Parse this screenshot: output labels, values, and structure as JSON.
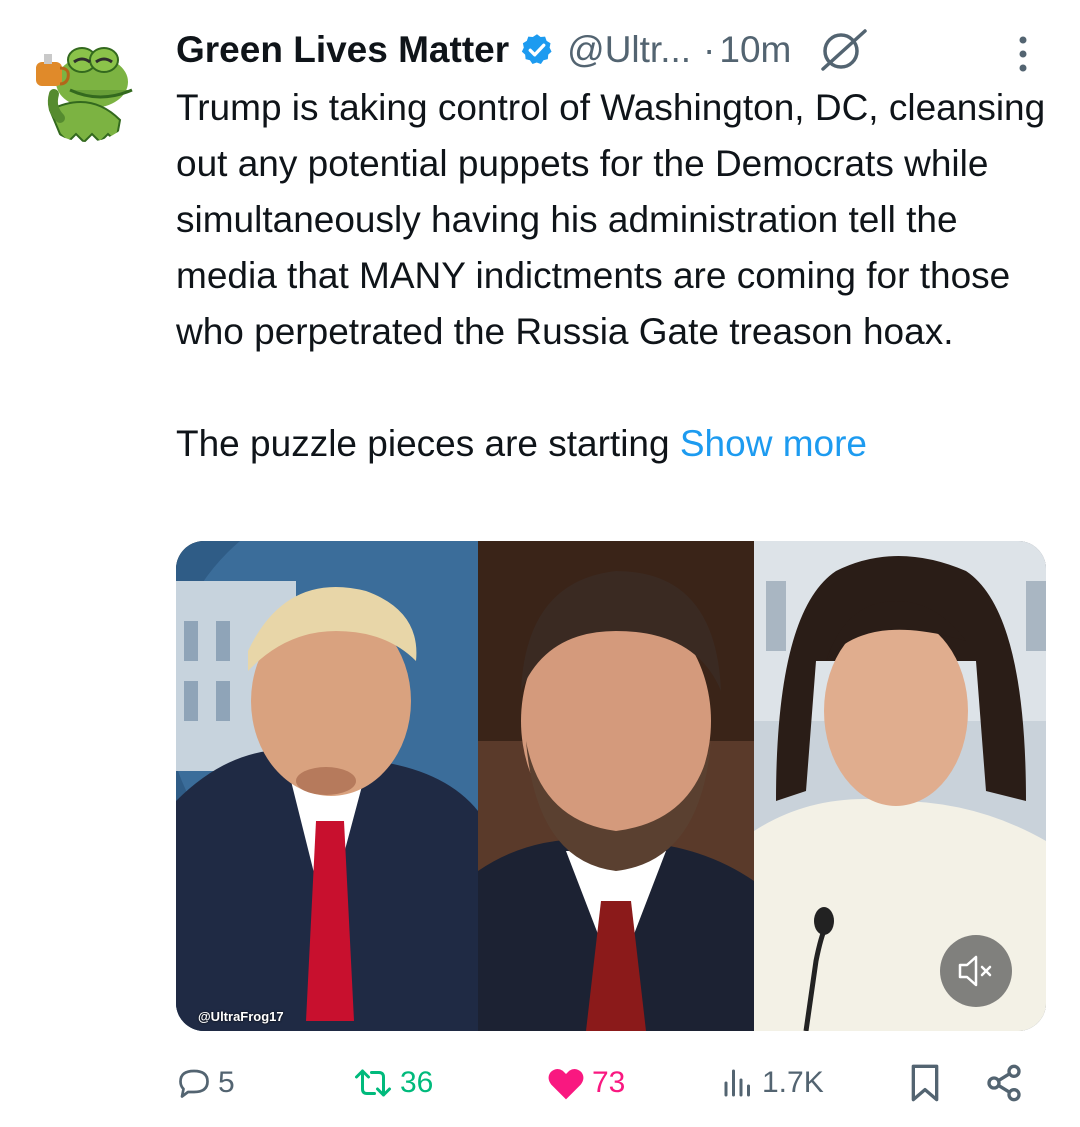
{
  "post": {
    "author_name": "Green Lives Matter",
    "handle": "@Ultr...",
    "separator": "·",
    "time": "10m",
    "body_paragraph_1": "Trump is taking control of Washington, DC, cleansing out any potential puppets for the Democrats while simultaneously having his administration tell the media that MANY indictments are coming for those who perpetrated the Russia Gate treason hoax.",
    "body_paragraph_2": "The puzzle pieces are starting",
    "show_more": "Show more",
    "media_watermark": "@UltraFrog17"
  },
  "actions": {
    "replies": "5",
    "reposts": "36",
    "likes": "73",
    "views": "1.7K"
  },
  "icons": {
    "verified": "verified-badge-icon",
    "grok": "grok-icon",
    "more": "more-options-icon",
    "mute": "muted-speaker-icon",
    "reply": "reply-icon",
    "repost": "repost-icon",
    "like": "heart-icon",
    "views": "views-icon",
    "bookmark": "bookmark-icon",
    "share": "share-icon"
  },
  "colors": {
    "text": "#0f1419",
    "secondary": "#536471",
    "link": "#1d9bf0",
    "repost": "#00ba7c",
    "like": "#f91880",
    "verified": "#1d9bf0"
  }
}
